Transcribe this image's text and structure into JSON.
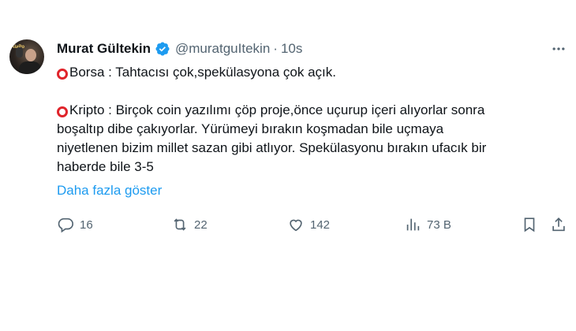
{
  "author": {
    "display_name": "Murat Gültekin",
    "handle": "@muratguItekin",
    "separator": "·",
    "time": "10s",
    "avatar_tag": "AlaPo"
  },
  "tweet": {
    "lines_section1": [
      "Borsa : Tahtacısı çok,spekülasyona çok açık."
    ],
    "lines_section2": [
      "Kripto : Birçok coin yazılımı çöp proje,önce uçurup içeri alıyorlar sonra",
      "boşaltıp dibe çakıyorlar. Yürümeyi bırakın koşmadan bile uçmaya",
      "niyetlenen bizim millet sazan gibi atlıyor. Spekülasyonu bırakın ufacık bir",
      "haberde bile 3-5"
    ],
    "show_more": "Daha fazla göster"
  },
  "actions": {
    "replies": "16",
    "retweets": "22",
    "likes": "142",
    "views": "73 B"
  },
  "colors": {
    "accent": "#1d9bf0",
    "muted": "#536471",
    "ring": "#e0242b"
  }
}
